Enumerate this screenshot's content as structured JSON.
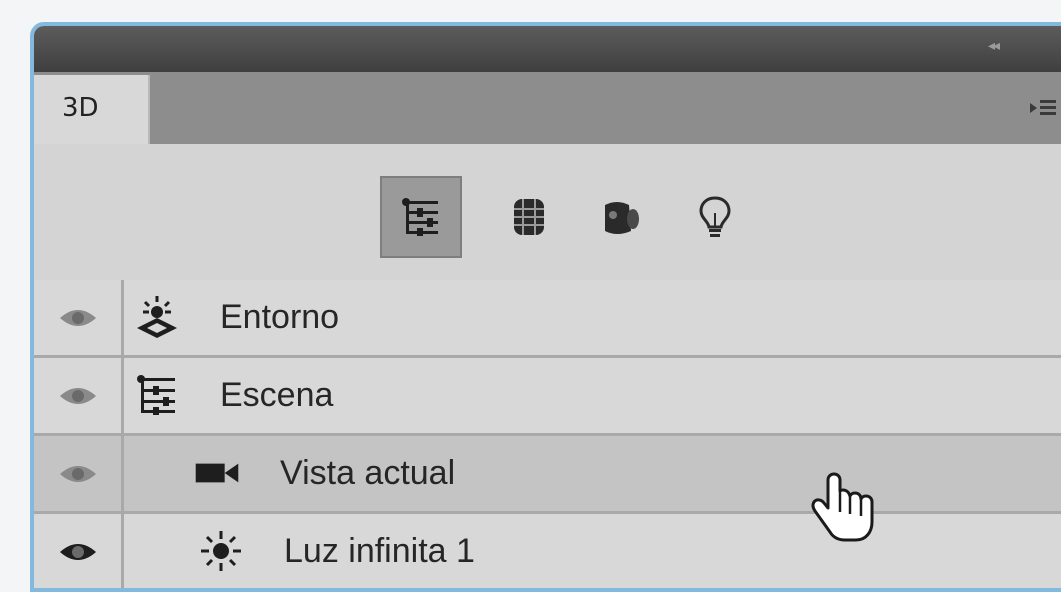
{
  "panel": {
    "tab_label": "3D",
    "toolbar": {
      "buttons": [
        {
          "icon": "scene-hierarchy-icon",
          "active": true
        },
        {
          "icon": "mesh-icon",
          "active": false
        },
        {
          "icon": "materials-icon",
          "active": false
        },
        {
          "icon": "lights-icon",
          "active": false
        }
      ]
    },
    "layers": [
      {
        "label": "Entorno",
        "icon": "environment-icon",
        "visible": false
      },
      {
        "label": "Escena",
        "icon": "scene-icon",
        "visible": false
      },
      {
        "label": "Vista actual",
        "icon": "camera-icon",
        "visible": false,
        "selected": true
      },
      {
        "label": "Luz infinita 1",
        "icon": "infinite-light-icon",
        "visible": true
      }
    ]
  },
  "colors": {
    "panel_bg": "#d6d6d6",
    "titlebar": "#4a4a4a",
    "frame_border": "#83b9dc",
    "active_tool_bg": "#9a9a9a"
  }
}
